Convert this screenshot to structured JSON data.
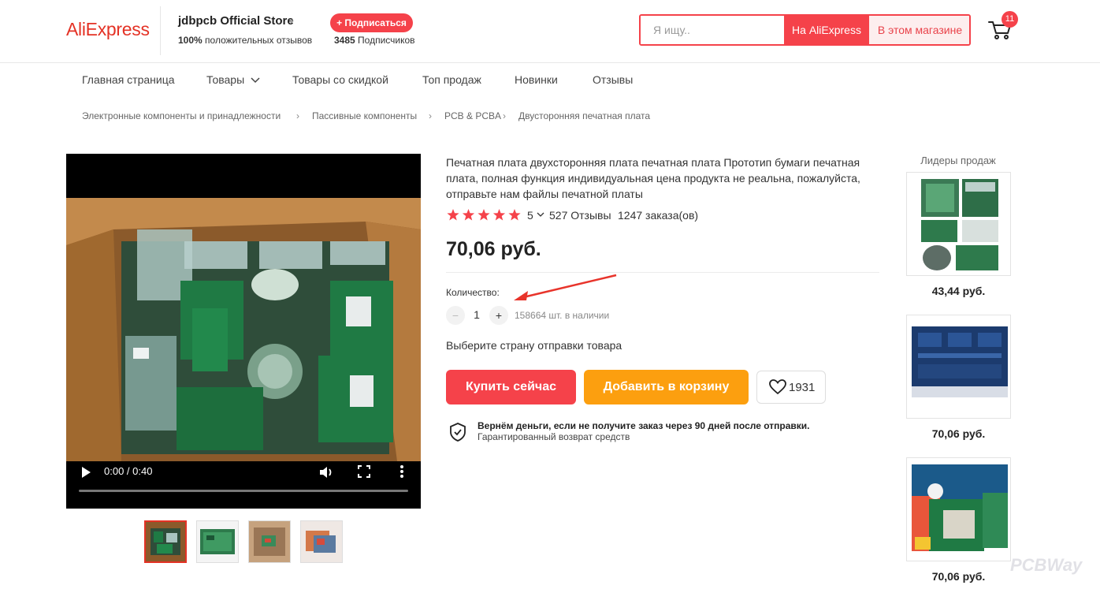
{
  "header": {
    "logo": "AliExpress",
    "store_name": "jdbpcb Official Store",
    "rating_percent": "100%",
    "rating_label": "положительных отзывов",
    "subscribe_label": "+ Подписаться",
    "subscribers_count": "3485",
    "subscribers_label": "Подписчиков",
    "search_placeholder": "Я ищу..",
    "search_ali_label": "На AliExpress",
    "search_store_label": "В этом магазине",
    "cart_count": "11"
  },
  "nav": {
    "items": [
      "Главная страница",
      "Товары",
      "Товары со скидкой",
      "Топ продаж",
      "Новинки",
      "Отзывы"
    ]
  },
  "breadcrumb": {
    "items": [
      "Электронные компоненты и принадлежности",
      "Пассивные компоненты",
      "PCB & PCBA",
      "Двусторонняя печатная плата"
    ]
  },
  "video": {
    "time": "0:00 / 0:40",
    "progress": 0.0
  },
  "product": {
    "title": "Печатная плата двухсторонняя плата печатная плата Прототип бумаги печатная плата, полная функция индивидуальная цена продукта не реальна, пожалуйста, отправьте нам файлы печатной платы",
    "rating": "5",
    "reviews": "527 Отзывы",
    "orders": "1247 заказа(ов)",
    "price": "70,06 руб.",
    "quantity_label": "Количество:",
    "quantity_minus": "−",
    "quantity_value": "1",
    "quantity_plus": "+",
    "stock": "158664 шт. в наличии",
    "ship_country": "Выберите страну отправки товара",
    "buy_now": "Купить сейчас",
    "add_to_cart": "Добавить в корзину",
    "wish_count": "1931",
    "guarantee_title": "Вернём деньги, если не получите заказ через 90 дней после отправки.",
    "guarantee_sub": "Гарантированный возврат средств"
  },
  "leaders": {
    "title": "Лидеры продаж",
    "items": [
      {
        "price": "43,44 руб."
      },
      {
        "price": "70,06 руб."
      },
      {
        "price": "70,06 руб."
      }
    ]
  },
  "watermark": "PCBWay",
  "colors": {
    "accent": "#f5424a",
    "logo": "#e43225",
    "cart_button": "#fc9f0f",
    "pcb_green": "#1f7a44"
  }
}
